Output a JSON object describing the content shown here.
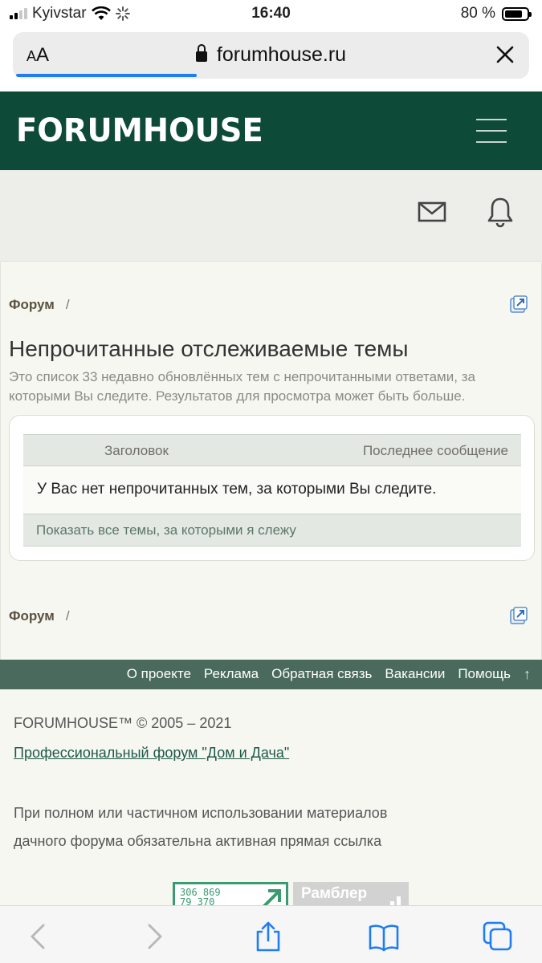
{
  "status_bar": {
    "carrier": "Kyivstar",
    "time": "16:40",
    "battery": "80 %",
    "battery_level": 0.8
  },
  "browser": {
    "text_size_label": "AA",
    "url": "forumhouse.ru",
    "load_progress": 0.35
  },
  "site": {
    "logo": "FORUMHOUSE"
  },
  "breadcrumb_top": {
    "label": "Форум",
    "separator": "/"
  },
  "page": {
    "title": "Непрочитанные отслеживаемые темы",
    "description": "Это список 33 недавно обновлённых тем с непрочитанными ответами, за которыми Вы следите. Результатов для просмотра может быть больше."
  },
  "table": {
    "columns": [
      "Заголовок",
      "Последнее сообщение"
    ],
    "empty_message": "У Вас нет непрочитанных тем, за которыми Вы следите.",
    "footer_link": "Показать все темы, за которыми я слежу"
  },
  "breadcrumb_bottom": {
    "label": "Форум",
    "separator": "/"
  },
  "footer": {
    "links": [
      "О проекте",
      "Реклама",
      "Обратная связь",
      "Вакансии",
      "Помощь"
    ],
    "up_arrow": "↑",
    "copyright": "FORUMHOUSE™ © 2005 – 2021",
    "pro_link": "Профессиональный форум \"Дом и Дача\"",
    "notice": "При полном или частичном использовании материалов дачного форума обязательна активная прямая ссылка",
    "counter_numbers": [
      "306 869",
      "79 370"
    ],
    "rambler_label": "Рамблер"
  },
  "colors": {
    "header_bg": "#0e4a38",
    "footer_bar": "#4a6a5e",
    "link": "#1d5a4a",
    "progress": "#1f7cf5"
  },
  "icons": [
    "signal-icon",
    "wifi-icon",
    "loading-icon",
    "battery-icon",
    "lock-icon",
    "close-icon",
    "menu-icon",
    "mail-icon",
    "bell-icon",
    "external-link-icon",
    "back-icon",
    "forward-icon",
    "share-icon",
    "bookmarks-icon",
    "tabs-icon"
  ]
}
